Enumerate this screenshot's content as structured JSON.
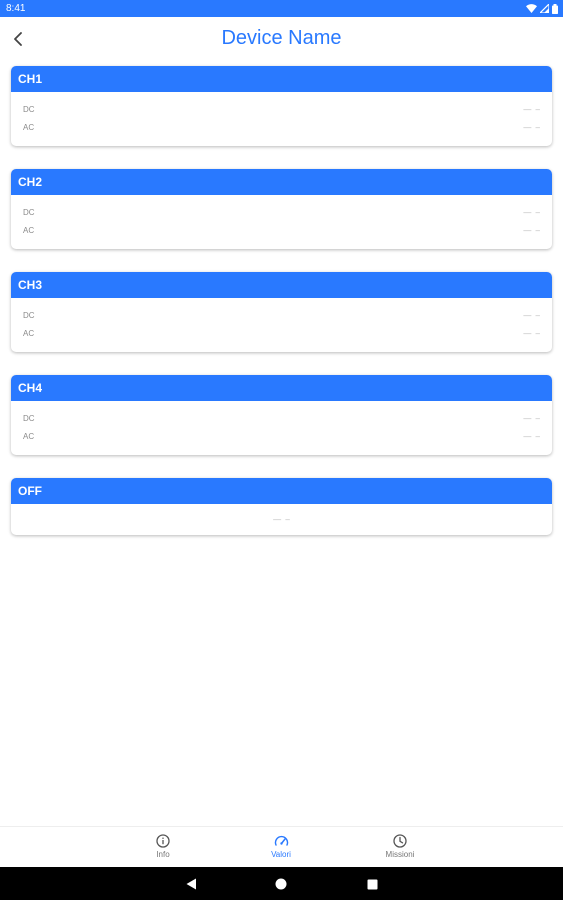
{
  "status_bar": {
    "time": "8:41",
    "icons": [
      "wifi-icon",
      "signal-icon",
      "battery-icon"
    ],
    "background": "#2979ff"
  },
  "header": {
    "title": "Device Name",
    "back_icon": "back-arrow-icon",
    "title_color": "#2979ff"
  },
  "channels": [
    {
      "name": "CH1",
      "rows": [
        {
          "label": "DC",
          "value": "— –"
        },
        {
          "label": "AC",
          "value": "— –"
        }
      ]
    },
    {
      "name": "CH2",
      "rows": [
        {
          "label": "DC",
          "value": "— –"
        },
        {
          "label": "AC",
          "value": "— –"
        }
      ]
    },
    {
      "name": "CH3",
      "rows": [
        {
          "label": "DC",
          "value": "— –"
        },
        {
          "label": "AC",
          "value": "— –"
        }
      ]
    },
    {
      "name": "CH4",
      "rows": [
        {
          "label": "DC",
          "value": "— –"
        },
        {
          "label": "AC",
          "value": "— –"
        }
      ]
    }
  ],
  "off_card": {
    "name": "OFF",
    "value": "— –"
  },
  "bottom_nav": {
    "items": [
      {
        "label": "Info",
        "icon": "info-icon",
        "active": false
      },
      {
        "label": "Valori",
        "icon": "gauge-icon",
        "active": true
      },
      {
        "label": "Missioni",
        "icon": "clock-icon",
        "active": false
      }
    ],
    "active_color": "#2979ff"
  },
  "system_nav": {
    "buttons": [
      "back-triangle-icon",
      "home-circle-icon",
      "recents-square-icon"
    ]
  }
}
